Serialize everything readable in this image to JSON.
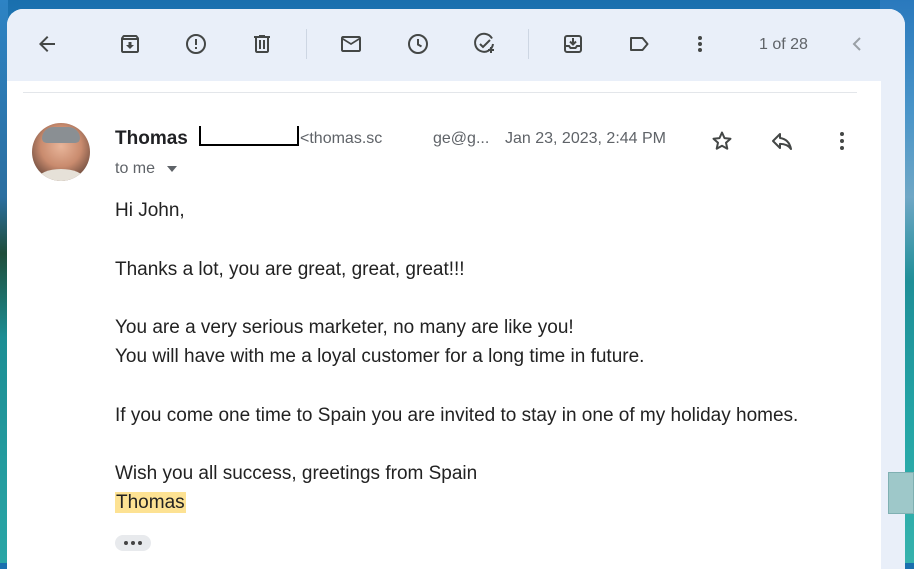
{
  "toolbar": {
    "back_label": "Back",
    "counter": "1 of 28"
  },
  "message": {
    "sender_name": "Thomas",
    "sender_email_start": "<thomas.sc",
    "sender_email_end": "ge@g...",
    "date": "Jan 23, 2023, 2:44 PM",
    "recipient": "to me",
    "body": [
      "Hi John,",
      "Thanks a lot, you are great, great, great!!!",
      "You are a very serious marketer, no many are like you!",
      "You will have with me a loyal customer for a long time in future.",
      "If you come one time to Spain you are invited to stay in one of my holiday homes.",
      "Wish you all success, greetings from Spain"
    ],
    "signature": "Thomas"
  },
  "colors": {
    "toolbar_bg": "#e9eff9",
    "highlight": "#fde293",
    "text": "#222222",
    "muted": "#5f6368"
  },
  "icons": [
    "back-icon",
    "archive-icon",
    "report-spam-icon",
    "delete-icon",
    "mark-unread-icon",
    "snooze-icon",
    "add-task-icon",
    "move-to-icon",
    "label-icon",
    "more-vert-icon",
    "older-icon",
    "star-icon",
    "reply-icon",
    "more-vert-icon",
    "dropdown-icon",
    "ellipsis-icon"
  ]
}
